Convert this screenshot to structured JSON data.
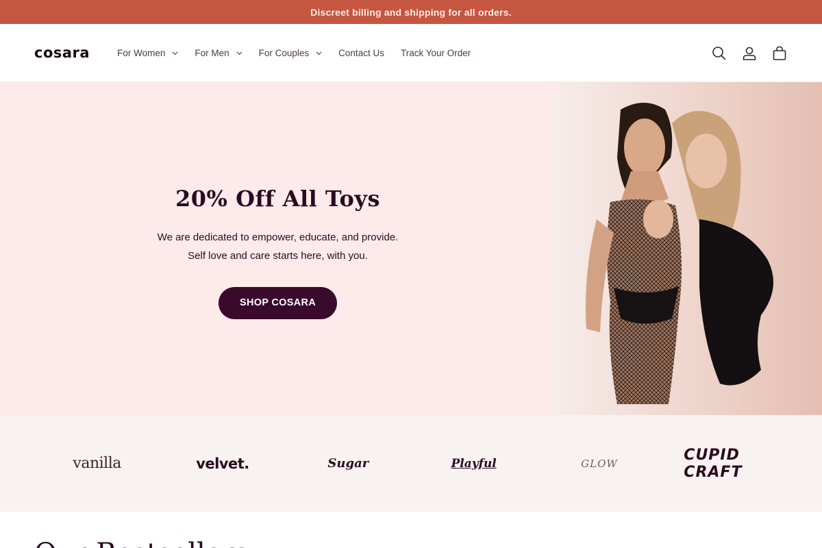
{
  "announcement": "Discreet billing and shipping for all orders.",
  "brand_name": "cosara",
  "nav": [
    {
      "label": "For Women",
      "dropdown": true
    },
    {
      "label": "For Men",
      "dropdown": true
    },
    {
      "label": "For Couples",
      "dropdown": true
    },
    {
      "label": "Contact Us",
      "dropdown": false
    },
    {
      "label": "Track Your Order",
      "dropdown": false
    }
  ],
  "header_icons": [
    "search-icon",
    "account-icon",
    "cart-icon"
  ],
  "hero": {
    "title": "20% Off All Toys",
    "line1": "We are dedicated to empower, educate, and provide.",
    "line2": "Self love and care starts here, with you.",
    "button": "SHOP COSARA"
  },
  "brands": {
    "vanilla": "vanilla",
    "velvet": "velvet.",
    "sugar": "Sugar",
    "playful": "Playful",
    "glow": "GLOW",
    "cupid": "CUPID CRAFT"
  },
  "section_title": "Our Bestsellers",
  "colors": {
    "announcement_bg": "#c5563f",
    "hero_bg": "#fdeaea",
    "button_bg": "#3a0a2d",
    "brands_bg": "#f8f2f0"
  }
}
